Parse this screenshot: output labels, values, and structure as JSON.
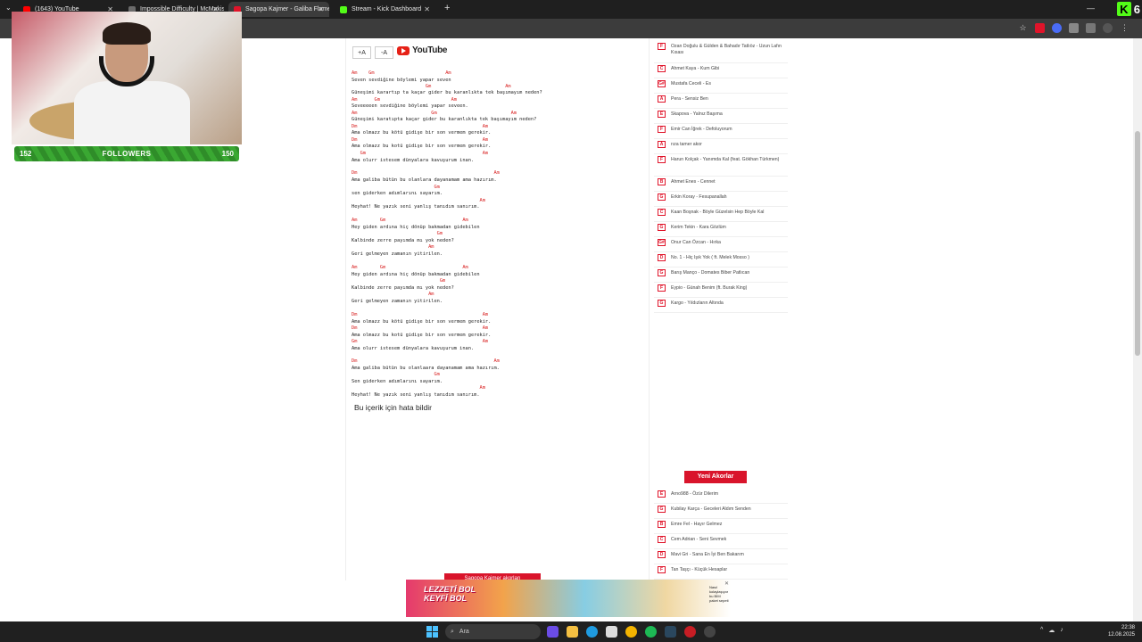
{
  "browser": {
    "tabs": [
      {
        "label": "(1643) YouTube",
        "color": "#ff0000"
      },
      {
        "label": "Impossible Difficulty | McMakis",
        "color": "#6b6b6b"
      },
      {
        "label": "Sagopa Kajmer - Galiba Flamen",
        "color": "#e0142a"
      },
      {
        "label": "Stream - Kick Dashboard",
        "color": "#53fc18"
      }
    ],
    "new_tab": "+",
    "kick_count": "6"
  },
  "stream": {
    "followers_label": "FOLLOWERS",
    "followers_current": "152",
    "followers_goal": "150"
  },
  "toolbar": {
    "increase_font": "+A",
    "decrease_font": "-A",
    "youtube": "YouTube"
  },
  "song_lines": [
    {
      "type": "chord",
      "text": "Am    Gm                         Am"
    },
    {
      "type": "lyric",
      "text": "Seven sevdiğine böylemi yapar seven"
    },
    {
      "type": "chord",
      "text": "                          Gm                          Am"
    },
    {
      "type": "lyric",
      "text": "Güneşimi karartıp ta kaçar gider bu karanlıkta tek başımayım neden?"
    },
    {
      "type": "chord",
      "text": "Am      Gm                         Am"
    },
    {
      "type": "lyric",
      "text": "Seveeeeen sevdiğine böylemi yapar seveen."
    },
    {
      "type": "chord",
      "text": "Am                          Gm                          Am"
    },
    {
      "type": "lyric",
      "text": "Güneşimi karatıpta kaçar gider bu karanlıkta tek başımayım neden?"
    },
    {
      "type": "chord",
      "text": "Dm                                            Am"
    },
    {
      "type": "lyric",
      "text": "Ama olmazz bu kötü gidişe bir son vermem gerekir."
    },
    {
      "type": "chord",
      "text": "Dm                                            Am"
    },
    {
      "type": "lyric",
      "text": "Ama olmazz bu kotü gidişe bir son vermem gerekir."
    },
    {
      "type": "chord",
      "text": "   Gm                                         Am"
    },
    {
      "type": "lyric",
      "text": "Ama olurr istesem dünyalara kavuşurum inan."
    },
    {
      "type": "chord",
      "text": "Dm                                                Am"
    },
    {
      "type": "lyric",
      "text": "Ama galiba bütün bu olanlara dayanamam ama hazırım."
    },
    {
      "type": "chord",
      "text": "                             Gm"
    },
    {
      "type": "lyric",
      "text": "sen giderken adımlarını sayarım."
    },
    {
      "type": "chord",
      "text": "                                             Am"
    },
    {
      "type": "lyric",
      "text": "Heyhat! Ne yazık seni yanlış tanıdım sanırım."
    },
    {
      "type": "chord",
      "text": "Am        Gm                           Am"
    },
    {
      "type": "lyric",
      "text": "Hey giden ardına hiç dönüp bakmadan gidebilen"
    },
    {
      "type": "chord",
      "text": "                              Gm"
    },
    {
      "type": "lyric",
      "text": "Kalbinde zerre payımda mı yok neden?"
    },
    {
      "type": "chord",
      "text": "                           Am"
    },
    {
      "type": "lyric",
      "text": "Geri gelmeyen zamanın yitirilen."
    },
    {
      "type": "chord",
      "text": "Am        Gm                           Am"
    },
    {
      "type": "lyric",
      "text": "Hey giden ardına hiç dönüp bakmadan gidebilen"
    },
    {
      "type": "chord",
      "text": "                               Gm"
    },
    {
      "type": "lyric",
      "text": "Kalbinde zerre payımda mı yok neden?"
    },
    {
      "type": "chord",
      "text": "                           Am"
    },
    {
      "type": "lyric",
      "text": "Geri gelmeyen zamanın yitirilen."
    },
    {
      "type": "chord",
      "text": "Dm                                            Am"
    },
    {
      "type": "lyric",
      "text": "Ama olmazz bu kötü gidişe bir son vermem gerekir."
    },
    {
      "type": "chord",
      "text": "Dm                                            Am"
    },
    {
      "type": "lyric",
      "text": "Ama olmazz bu kotü gidişe bir son vermem gerekir."
    },
    {
      "type": "chord",
      "text": "Gm                                            Am"
    },
    {
      "type": "lyric",
      "text": "Ama olurr istesem dünyalara kavuşurum inan."
    },
    {
      "type": "chord",
      "text": "Dm                                                Am"
    },
    {
      "type": "lyric",
      "text": "Ama galiba bütün bu olanlaara dayanamam ama hazırım."
    },
    {
      "type": "chord",
      "text": "                             Gm"
    },
    {
      "type": "lyric",
      "text": "Sen giderken adımlarını sayarım."
    },
    {
      "type": "chord",
      "text": "                                             Am"
    },
    {
      "type": "lyric",
      "text": "Heyhat! Ne yazık seni yanlış tanıdım sanırım."
    }
  ],
  "report_text": "Bu içerik için hata bildir",
  "artist_chords_button": "Sagopa Kajmer akorları",
  "sidebar": {
    "songs": [
      {
        "key": "F",
        "title": "Ozan Doğulu & Gülden & Bahadır Tatlıöz - Uzun Lafın Kısası"
      },
      {
        "key": "C",
        "title": "Ahmet Kaya - Kum Gibi"
      },
      {
        "key": "G#",
        "title": "Mustafa Ceceli - Es"
      },
      {
        "key": "A",
        "title": "Pera - Sensiz Ben"
      },
      {
        "key": "E",
        "title": "Skapova - Yalnız Başıma"
      },
      {
        "key": "F",
        "title": "Emir Can İğrek - Defoluyorum"
      },
      {
        "key": "A",
        "title": "rıza tamer akor"
      },
      {
        "key": "F",
        "title": "Harun Kolçak - Yanımda Kal (feat. Gökhan Türkmen)"
      },
      {
        "key": "B",
        "title": "Ahmet Enes - Cennet"
      },
      {
        "key": "G",
        "title": "Erkin Koray - Fesupanallah"
      },
      {
        "key": "C",
        "title": "Kaan Boşnak - Böyle Güzelsin Hep Böyle Kal"
      },
      {
        "key": "G",
        "title": "Kerim Tekin - Kara Gözlüm"
      },
      {
        "key": "G#",
        "title": "Onur Can Özcan - Hırka"
      },
      {
        "key": "D",
        "title": "No. 1 - Hiç Işık Yok ( ft. Melek Mosso )"
      },
      {
        "key": "G",
        "title": "Barış Manço - Domates Biber Patlıcan"
      },
      {
        "key": "F",
        "title": "Eypio - Günah Benim (ft. Burak King)"
      },
      {
        "key": "G",
        "title": "Kargo - Yıldızların Altında"
      }
    ],
    "new_chords_label": "Yeni Akorlar",
    "new_songs": [
      {
        "key": "E",
        "title": "Arno988 - Özür Dilerim"
      },
      {
        "key": "G",
        "title": "Kubilay Karça - Geceleri Aldım Senden"
      },
      {
        "key": "B",
        "title": "Emre Fel - Hayır Gelmez"
      },
      {
        "key": "C",
        "title": "Cem Adrian - Seni Sevmek"
      },
      {
        "key": "D",
        "title": "Mavi Gri - Sana En İyi Ben Bakarım"
      },
      {
        "key": "F",
        "title": "Tan Taşçı - Küçük Hesaplar"
      }
    ]
  },
  "ad": {
    "headline": "LEZZETİ BOL\nKEYFİ BOL",
    "side_text": "Nasıl kolaylaşıyor bu BİM paket sepeti"
  },
  "taskbar": {
    "search_placeholder": "Ara",
    "time": "22:38",
    "date": "12.08.2025"
  }
}
